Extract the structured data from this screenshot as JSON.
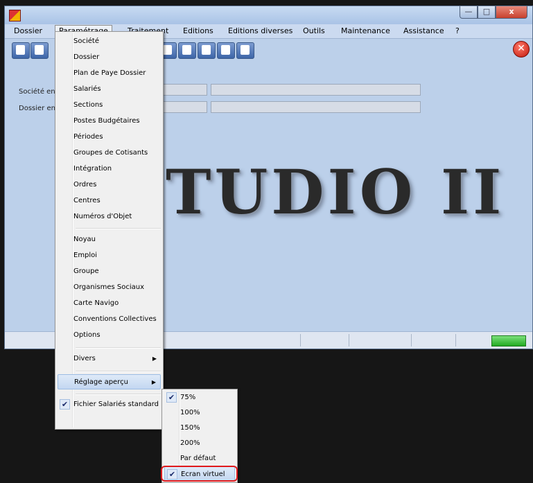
{
  "menubar": {
    "items": [
      "Dossier",
      "Paramétrage",
      "Traitement",
      "Editions",
      "Editions diverses",
      "Outils",
      "Maintenance",
      "Assistance",
      "?"
    ]
  },
  "window_buttons": {
    "minimize": "—",
    "maximize": "□",
    "close": "x"
  },
  "exit_button": {
    "glyph": "✕"
  },
  "form": {
    "societe_label": "Société en",
    "dossier_label": "Dossier en"
  },
  "logo": {
    "text": "TUDIO II"
  },
  "parametrage_menu": {
    "group1": [
      "Société",
      "Dossier",
      "Plan de Paye Dossier",
      "Salariés",
      "Sections",
      "Postes Budgétaires",
      "Périodes",
      "Groupes de Cotisants",
      "Intégration",
      "Ordres",
      "Centres",
      "Numéros d'Objet"
    ],
    "group2": [
      "Noyau",
      "Emploi",
      "Groupe",
      "Organismes Sociaux",
      "Carte Navigo",
      "Conventions Collectives",
      "Options"
    ],
    "divers": "Divers",
    "reglage": "Réglage aperçu",
    "fichier": "Fichier Salariés standard"
  },
  "reglage_submenu": {
    "items": [
      "75%",
      "100%",
      "150%",
      "200%",
      "Par défaut",
      "Ecran virtuel"
    ],
    "checked": [
      "75%",
      "Ecran virtuel"
    ]
  },
  "icons": {
    "check": "✔",
    "submenu_arrow": "▶"
  },
  "colors": {
    "highlight_box": "#e0191c",
    "status_indicator": "#22aa22"
  }
}
